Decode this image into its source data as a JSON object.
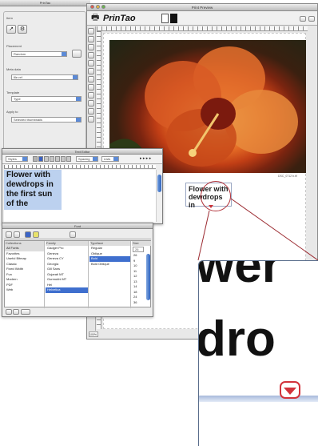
{
  "palette": {
    "title": "PrinTao",
    "section": "Item",
    "placement_label": "Placement",
    "placement_value": "Random",
    "meta_label": "Meta data",
    "meta_value": "file ref",
    "template_label": "Template",
    "template_value": "Type",
    "apply_label": "Apply to",
    "apply_value": "Selected thumbnails"
  },
  "preview": {
    "title": "Print Preview",
    "app_name": "PrinTao",
    "caption": "Flower with dewdrops in",
    "filename": "DSC_0712 b.tif",
    "zoom": "100%"
  },
  "text_editor": {
    "title": "Text Editor",
    "style_value": "Styles",
    "spacing_label": "Spacing",
    "lists_label": "Lists",
    "content": "Flower with dewdrops in the first sun of the",
    "icon_colors": [
      "#b3b3b3",
      "#3b62c4",
      "#c7c7c7",
      "#c7c7c7",
      "#c7c7c7",
      "#c7c7c7",
      "#c7c7c7"
    ]
  },
  "font_panel": {
    "title": "Font",
    "collections_header": "Collections",
    "family_header": "Family",
    "typeface_header": "Typeface",
    "size_header": "Size",
    "collections": [
      "All Fonts",
      "Favorites",
      "Useful Bitmap",
      "Classic",
      "Fixed Width",
      "Fun",
      "Modern",
      "PDF",
      "Web"
    ],
    "families": [
      "Gadget Pro",
      "Geneva",
      "Geneva CY",
      "Georgia",
      "Gill Sans",
      "Gujarati MT",
      "Gurmukhi MT",
      "Hei",
      "Helvetica"
    ],
    "typefaces": [
      "Regular",
      "Oblique",
      "Bold",
      "Bold Oblique"
    ],
    "sizes": [
      "26",
      "9",
      "10",
      "11",
      "12",
      "13",
      "14",
      "18",
      "24",
      "36"
    ],
    "size_value": "26",
    "selected_family": "Helvetica",
    "selected_typeface": "Bold"
  },
  "zoom": {
    "text_lines": [
      "wer",
      "dro"
    ]
  }
}
